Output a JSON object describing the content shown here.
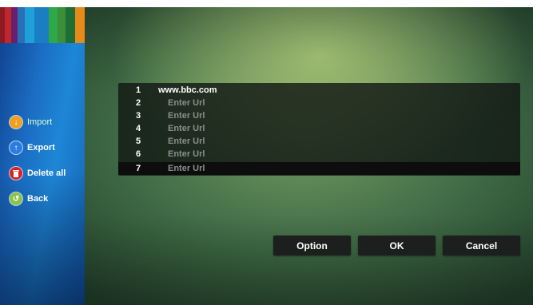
{
  "sidebar": {
    "items": [
      {
        "label": "Import",
        "icon": "import-icon",
        "color": "#f0a020"
      },
      {
        "label": "Export",
        "icon": "export-icon",
        "color": "#2a7ee0"
      },
      {
        "label": "Delete all",
        "icon": "trash-icon",
        "color": "#e02020"
      },
      {
        "label": "Back",
        "icon": "back-icon",
        "color": "#8bc34a"
      }
    ],
    "color_bars": [
      "#8b1a22",
      "#c0262e",
      "#6a1f6e",
      "#2a6fb5",
      "#1fa0d8",
      "#1a7fc2",
      "#2fa84a",
      "#3b8f3a",
      "#1f6e35",
      "#e88a1a"
    ]
  },
  "url_list": {
    "rows": [
      {
        "num": "1",
        "text": "www.bbc.com"
      },
      {
        "num": "2",
        "text": "Enter Url"
      },
      {
        "num": "3",
        "text": "Enter Url"
      },
      {
        "num": "4",
        "text": "Enter Url"
      },
      {
        "num": "5",
        "text": "Enter Url"
      },
      {
        "num": "6",
        "text": "Enter Url"
      },
      {
        "num": "7",
        "text": "Enter Url"
      }
    ],
    "selected_row": "7"
  },
  "buttons": {
    "option": "Option",
    "ok": "OK",
    "cancel": "Cancel"
  }
}
